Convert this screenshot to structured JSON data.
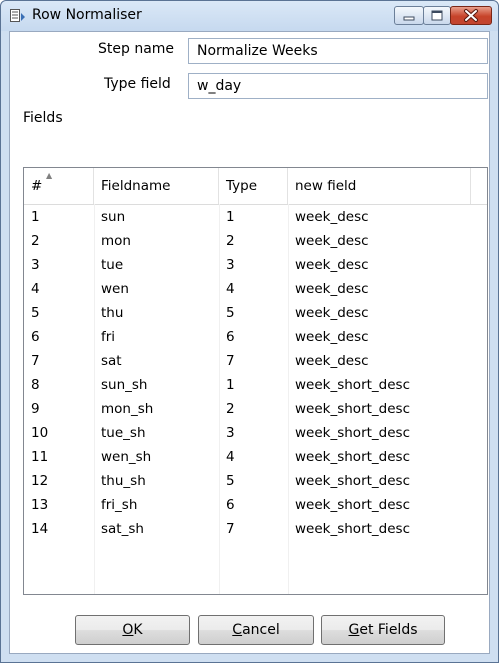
{
  "window": {
    "title": "Row Normaliser"
  },
  "form": {
    "step_name_label": "Step name",
    "step_name_value": "Normalize Weeks",
    "type_field_label": "Type field",
    "type_field_value": "w_day",
    "fields_label": "Fields"
  },
  "table": {
    "columns": [
      "#",
      "Fieldname",
      "Type",
      "new field"
    ],
    "rows": [
      [
        "1",
        "sun",
        "1",
        "week_desc"
      ],
      [
        "2",
        "mon",
        "2",
        "week_desc"
      ],
      [
        "3",
        "tue",
        "3",
        "week_desc"
      ],
      [
        "4",
        "wen",
        "4",
        "week_desc"
      ],
      [
        "5",
        "thu",
        "5",
        "week_desc"
      ],
      [
        "6",
        "fri",
        "6",
        "week_desc"
      ],
      [
        "7",
        "sat",
        "7",
        "week_desc"
      ],
      [
        "8",
        "sun_sh",
        "1",
        "week_short_desc"
      ],
      [
        "9",
        "mon_sh",
        "2",
        "week_short_desc"
      ],
      [
        "10",
        "tue_sh",
        "3",
        "week_short_desc"
      ],
      [
        "11",
        "wen_sh",
        "4",
        "week_short_desc"
      ],
      [
        "12",
        "thu_sh",
        "5",
        "week_short_desc"
      ],
      [
        "13",
        "fri_sh",
        "6",
        "week_short_desc"
      ],
      [
        "14",
        "sat_sh",
        "7",
        "week_short_desc"
      ]
    ]
  },
  "buttons": {
    "ok": {
      "mnemonic": "O",
      "rest": "K"
    },
    "cancel": {
      "mnemonic": "C",
      "rest": "ancel"
    },
    "get_fields": {
      "mnemonic": "G",
      "rest": "et Fields"
    }
  },
  "icons": {
    "app": "row-normaliser-icon",
    "sort": "sort-ascending-icon",
    "minimize": "minimize-icon",
    "maximize": "maximize-icon",
    "close": "close-icon"
  },
  "colors": {
    "close_button": "#c7432a",
    "title_bar": "#c6d9ef"
  }
}
